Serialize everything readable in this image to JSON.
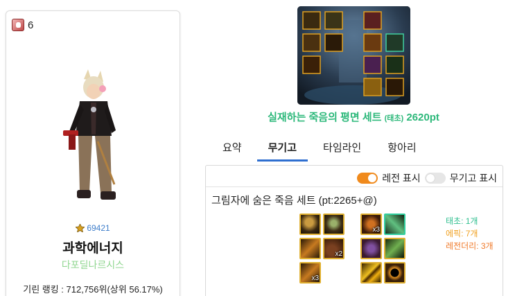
{
  "character": {
    "server_count": "6",
    "fame_value": "69421",
    "name": "과학에너지",
    "class": "다포딜나르시스",
    "ranking": "기린 랭킹 : 712,756위(상위 56.17%)"
  },
  "set": {
    "title_main": "실재하는 죽음의 평면 세트",
    "title_grade": "(태초)",
    "title_points": "2620pt"
  },
  "tabs": [
    {
      "label": "요약"
    },
    {
      "label": "무기고"
    },
    {
      "label": "타임라인"
    },
    {
      "label": "항아리"
    }
  ],
  "toggles": {
    "legend_label": "레전 표시",
    "armory_label": "무기고 표시"
  },
  "set_line": "그림자에 숨은 죽음 세트 (pt:2265+@)",
  "counts": {
    "taecho": "태초: 1개",
    "epic": "에픽: 7개",
    "legendary": "레전더리: 3개"
  },
  "items": [
    {
      "qty": ""
    },
    {
      "qty": ""
    },
    {
      "qty": ""
    },
    {
      "qty": "x2"
    },
    {
      "qty": "x3"
    },
    {
      "qty": "x3"
    },
    {
      "qty": ""
    },
    {
      "qty": ""
    },
    {
      "qty": ""
    },
    {
      "qty": ""
    },
    {
      "qty": ""
    }
  ]
}
